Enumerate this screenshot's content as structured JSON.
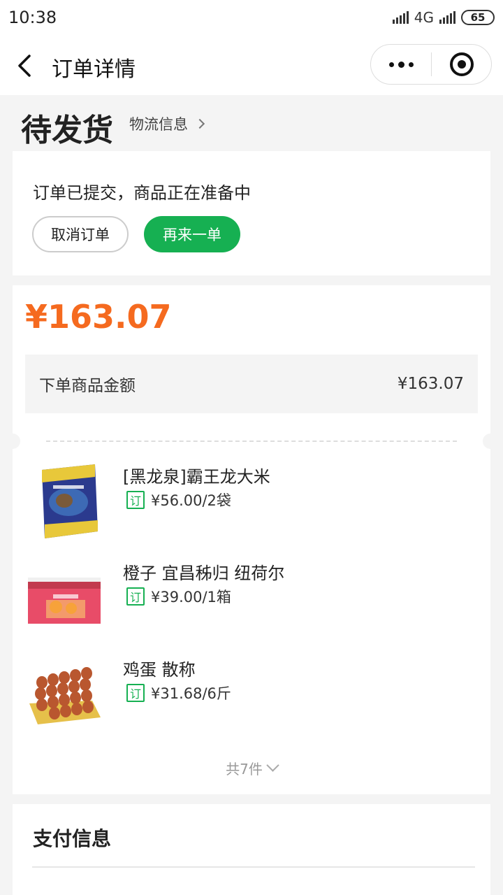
{
  "status_bar": {
    "time": "10:38",
    "network": "4G",
    "battery": "65"
  },
  "nav": {
    "title": "订单详情"
  },
  "order_state": {
    "title": "待发货",
    "logistics_label": "物流信息"
  },
  "status_card": {
    "message": "订单已提交，商品正在准备中",
    "cancel_label": "取消订单",
    "reorder_label": "再来一单"
  },
  "order": {
    "total": "¥163.07",
    "amount_label": "下单商品金额",
    "amount_value": "¥163.07",
    "items": [
      {
        "name": "[黑龙泉]霸王龙大米",
        "tag": "订",
        "price": "¥56.00/2袋"
      },
      {
        "name": "橙子 宜昌秭归 纽荷尔",
        "tag": "订",
        "price": "¥39.00/1箱"
      },
      {
        "name": "鸡蛋 散称",
        "tag": "订",
        "price": "¥31.68/6斤"
      }
    ],
    "expand_label": "共7件"
  },
  "payment": {
    "title": "支付信息"
  },
  "colors": {
    "accent_green": "#16b052",
    "price_orange": "#f56a1f"
  }
}
